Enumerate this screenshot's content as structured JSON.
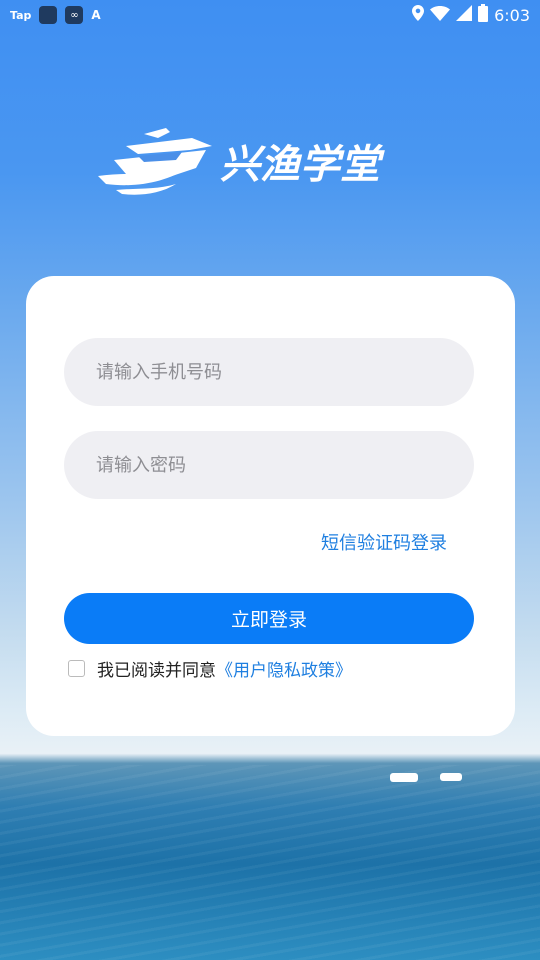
{
  "status_bar": {
    "app_label": "Tap",
    "time": "6:03",
    "icons": [
      "taptap-icon",
      "app-square-icon",
      "infinity-app-icon",
      "font-app-icon",
      "location-icon",
      "wifi-icon",
      "signal-icon",
      "battery-icon"
    ]
  },
  "brand": {
    "logo_text": "兴渔学堂",
    "logo_icon": "boat-logo-icon"
  },
  "login": {
    "phone_placeholder": "请输入手机号码",
    "password_placeholder": "请输入密码",
    "sms_login_link": "短信验证码登录",
    "submit_label": "立即登录",
    "agreement_text": "我已阅读并同意",
    "policy_link": "《用户隐私政策》"
  },
  "colors": {
    "primary_button": "#0a7cf7",
    "link": "#1f7fe0",
    "input_bg": "#efeff3",
    "sky": "#4a97f1",
    "sea": "#1d72a8"
  }
}
